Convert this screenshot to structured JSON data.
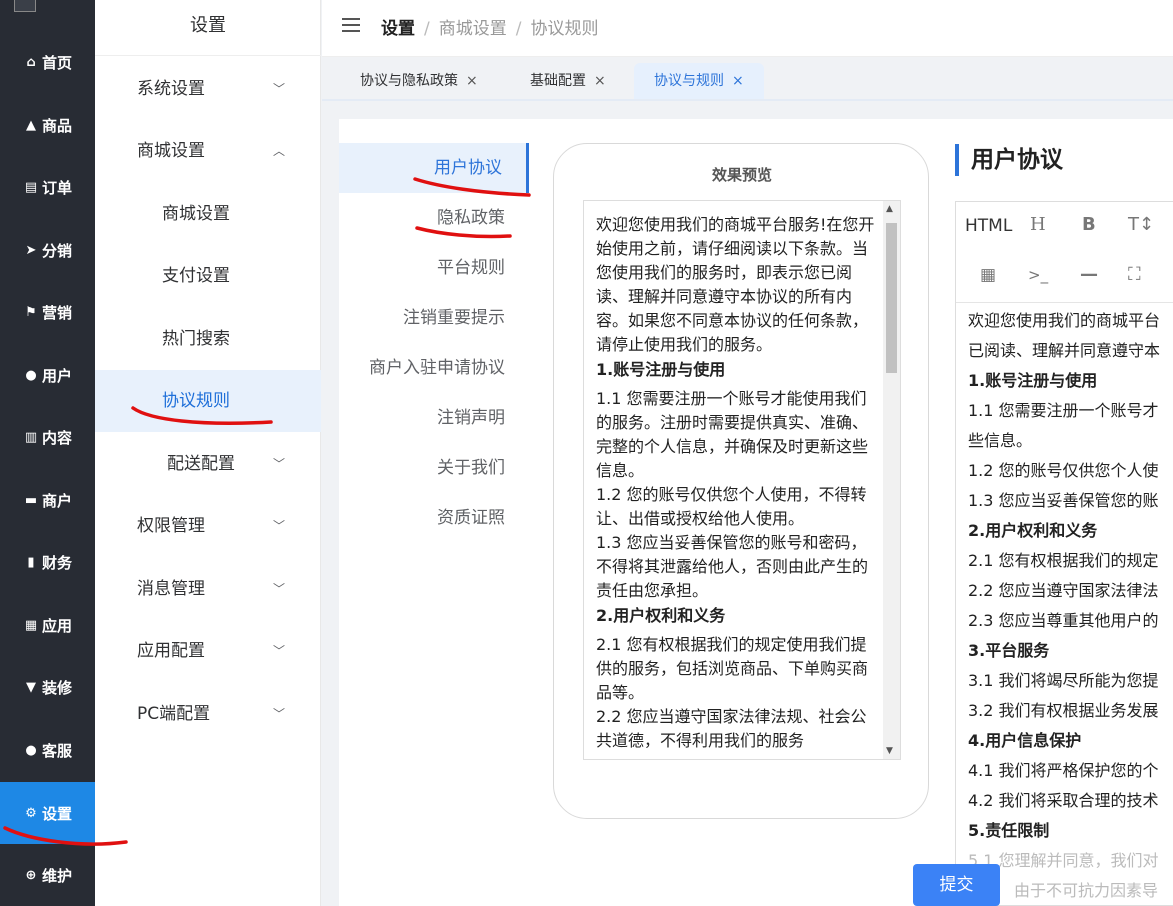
{
  "nav": {
    "items": [
      {
        "icon": "home-icon",
        "glyph": "⌂",
        "label": "首页"
      },
      {
        "icon": "bag-icon",
        "glyph": "▲",
        "label": "商品"
      },
      {
        "icon": "order-icon",
        "glyph": "▤",
        "label": "订单"
      },
      {
        "icon": "send-icon",
        "glyph": "➤",
        "label": "分销"
      },
      {
        "icon": "flag-icon",
        "glyph": "⚑",
        "label": "营销"
      },
      {
        "icon": "user-icon",
        "glyph": "●",
        "label": "用户"
      },
      {
        "icon": "content-icon",
        "glyph": "▥",
        "label": "内容"
      },
      {
        "icon": "merchant-icon",
        "glyph": "▬",
        "label": "商户"
      },
      {
        "icon": "finance-icon",
        "glyph": "▮",
        "label": "财务"
      },
      {
        "icon": "apps-icon",
        "glyph": "▦",
        "label": "应用"
      },
      {
        "icon": "decor-icon",
        "glyph": "▼",
        "label": "装修"
      },
      {
        "icon": "service-icon",
        "glyph": "●",
        "label": "客服"
      },
      {
        "icon": "gear-icon",
        "glyph": "⚙",
        "label": "设置"
      },
      {
        "icon": "maintain-icon",
        "glyph": "⊕",
        "label": "维护"
      }
    ]
  },
  "submenu": {
    "title": "设置",
    "items": [
      {
        "label": "系统设置",
        "chevron": "﹀"
      },
      {
        "label": "商城设置",
        "chevron": "︿"
      },
      {
        "label": "商城设置",
        "chevron": ""
      },
      {
        "label": "支付设置",
        "chevron": ""
      },
      {
        "label": "热门搜索",
        "chevron": ""
      },
      {
        "label": "协议规则",
        "chevron": ""
      },
      {
        "label": "配送配置",
        "chevron": "﹀"
      },
      {
        "label": "权限管理",
        "chevron": "﹀"
      },
      {
        "label": "消息管理",
        "chevron": "﹀"
      },
      {
        "label": "应用配置",
        "chevron": "﹀"
      },
      {
        "label": "PC端配置",
        "chevron": "﹀"
      }
    ]
  },
  "header": {
    "breadcrumb": [
      "设置",
      "商城设置",
      "协议规则"
    ],
    "separator": "/"
  },
  "tabs": [
    {
      "label": "协议与隐私政策",
      "close": "×"
    },
    {
      "label": "基础配置",
      "close": "×"
    },
    {
      "label": "协议与规则",
      "close": "×"
    }
  ],
  "side_tabs": [
    "用户协议",
    "隐私政策",
    "平台规则",
    "注销重要提示",
    "商户入驻申请协议",
    "注销声明",
    "关于我们",
    "资质证照"
  ],
  "preview": {
    "title": "效果预览",
    "lines": [
      "欢迎您使用我们的商城平台服务!在您开始使用之前，请仔细阅读以下条款。当您使用我们的服务时，即表示您已阅读、理解并同意遵守本协议的所有内容。如果您不同意本协议的任何条款，请停止使用我们的服务。",
      "1.账号注册与使用",
      "1.1 您需要注册一个账号才能使用我们的服务。注册时需要提供真实、准确、完整的个人信息，并确保及时更新这些信息。",
      "1.2 您的账号仅供您个人使用，不得转让、出借或授权给他人使用。",
      "1.3 您应当妥善保管您的账号和密码，不得将其泄露给他人，否则由此产生的责任由您承担。",
      "2.用户权利和义务",
      "2.1 您有权根据我们的规定使用我们提供的服务，包括浏览商品、下单购买商品等。",
      "2.2 您应当遵守国家法律法规、社会公共道德，不得利用我们的服务"
    ]
  },
  "editor": {
    "title": "用户协议",
    "toolbar": {
      "html": "HTML",
      "heading": "H",
      "bold": "B",
      "font_size": "T↕",
      "video": "▦",
      "code": ">_",
      "hr": "—",
      "fullscreen": "⛶"
    },
    "lines": [
      "欢迎您使用我们的商城平台",
      "已阅读、理解并同意遵守本",
      "1.账号注册与使用",
      "1.1 您需要注册一个账号才",
      "些信息。",
      "1.2 您的账号仅供您个人使",
      "1.3 您应当妥善保管您的账",
      "2.用户权利和义务",
      "2.1 您有权根据我们的规定",
      "2.2 您应当遵守国家法律法",
      "2.3 您应当尊重其他用户的",
      "3.平台服务",
      "3.1 我们将竭尽所能为您提",
      "3.2 我们有权根据业务发展",
      "4.用户信息保护",
      "4.1 我们将严格保护您的个",
      "4.2 我们将采取合理的技术",
      "5.责任限制",
      "5.1 您理解并同意，我们对",
      "由于不可抗力因素导"
    ]
  },
  "submit_label": "提交",
  "colors": {
    "accent": "#2d74d9",
    "nav_bg": "#282c34",
    "nav_active": "#1e88e5",
    "annotation": "#e01010"
  }
}
